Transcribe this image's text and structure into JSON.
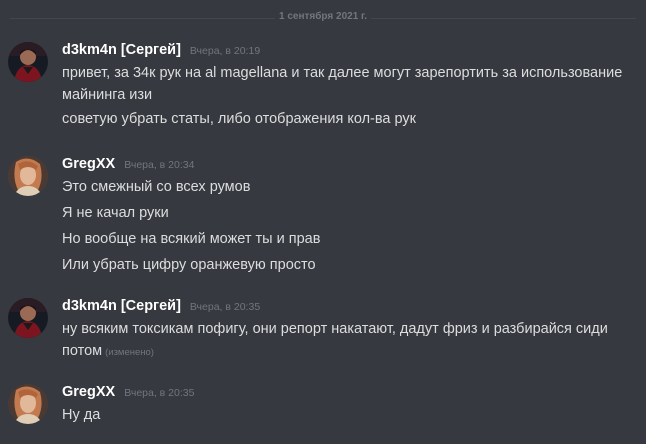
{
  "channel": {
    "date_divider": "1 сентября 2021 г."
  },
  "users": {
    "d3km4n": {
      "name": "d3km4n [Сергей]",
      "avatar_icon": "user-avatar-dark-icon"
    },
    "gregxx": {
      "name": "GregXX",
      "avatar_icon": "user-avatar-girl-icon"
    }
  },
  "messages": [
    {
      "author": "d3km4n [Сергей]",
      "timestamp": "Вчера, в 20:19",
      "lines": [
        "привет, за 34к рук на al magellana и так далее могут зарепортить за использование майнинга изи",
        "советую убрать статы, либо отображения кол-ва рук"
      ]
    },
    {
      "author": "GregXX",
      "timestamp": "Вчера, в 20:34",
      "lines": [
        "Это смежный со всех румов",
        "Я не качал руки",
        "Но вообще на всякий может ты и прав",
        "Или убрать цифру оранжевую просто"
      ]
    },
    {
      "author": "d3km4n [Сергей]",
      "timestamp": "Вчера, в 20:35",
      "lines": [
        "ну всяким токсикам пофигу, они репорт накатают, дадут фриз и разбирайся сиди потом"
      ],
      "edited": "(изменено)"
    },
    {
      "author": "GregXX",
      "timestamp": "Вчера, в 20:35",
      "lines": [
        "Ну да"
      ]
    }
  ],
  "colors": {
    "background": "#36393f",
    "username": "#ffffff",
    "text": "#dcddde",
    "muted": "#72767d"
  }
}
